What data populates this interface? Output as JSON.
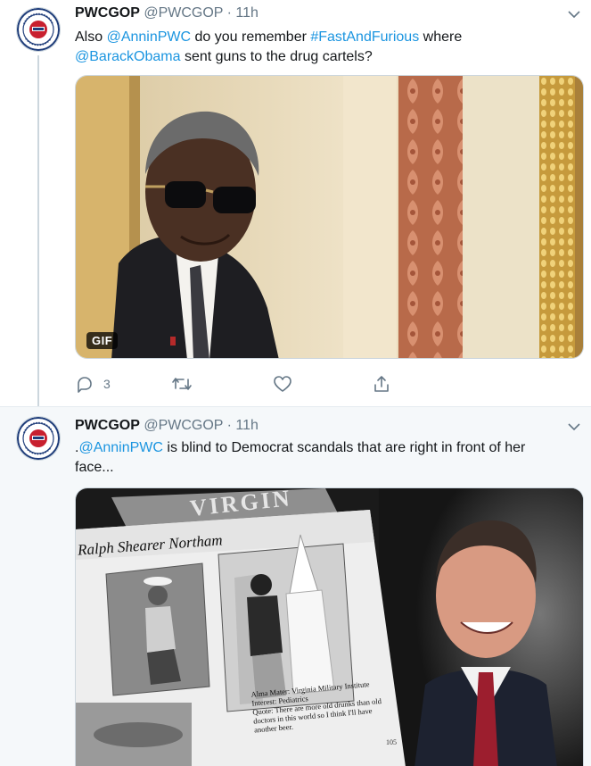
{
  "tweets": [
    {
      "name": "PWCGOP",
      "handle": "@PWCGOP",
      "separator": "·",
      "time": "11h",
      "text_parts": [
        "Also ",
        "@AnninPWC",
        " do you remember ",
        "#FastAndFurious",
        " where ",
        "@BarackObama",
        " sent guns to the drug cartels?"
      ],
      "media_badge": "GIF",
      "reply_count": "3"
    },
    {
      "name": "PWCGOP",
      "handle": "@PWCGOP",
      "separator": "·",
      "time": "11h",
      "text_parts": [
        ".",
        "@AnninPWC",
        " is blind to Democrat scandals that are right in front of her face..."
      ],
      "image_texts": {
        "banner": "VIRGIN",
        "yearbook_name": "Ralph Shearer Northam",
        "caption_line1": "Alma Mater: Virginia Military Institute",
        "caption_line2": "Interest: Pediatrics",
        "caption_line3": "Quote: There are more old drunks than old",
        "caption_line4": "doctors in this world so I think I'll have",
        "caption_line5": "another beer.",
        "page_number": "105"
      }
    }
  ],
  "icons": {
    "caret": "chevron-down-icon",
    "reply": "reply-icon",
    "retweet": "retweet-icon",
    "like": "heart-icon",
    "share": "share-icon"
  },
  "colors": {
    "link": "#1b95e0",
    "secondary_text": "#657786",
    "thread_line": "#ccd6dd",
    "focused_bg": "#f5f8fa"
  }
}
